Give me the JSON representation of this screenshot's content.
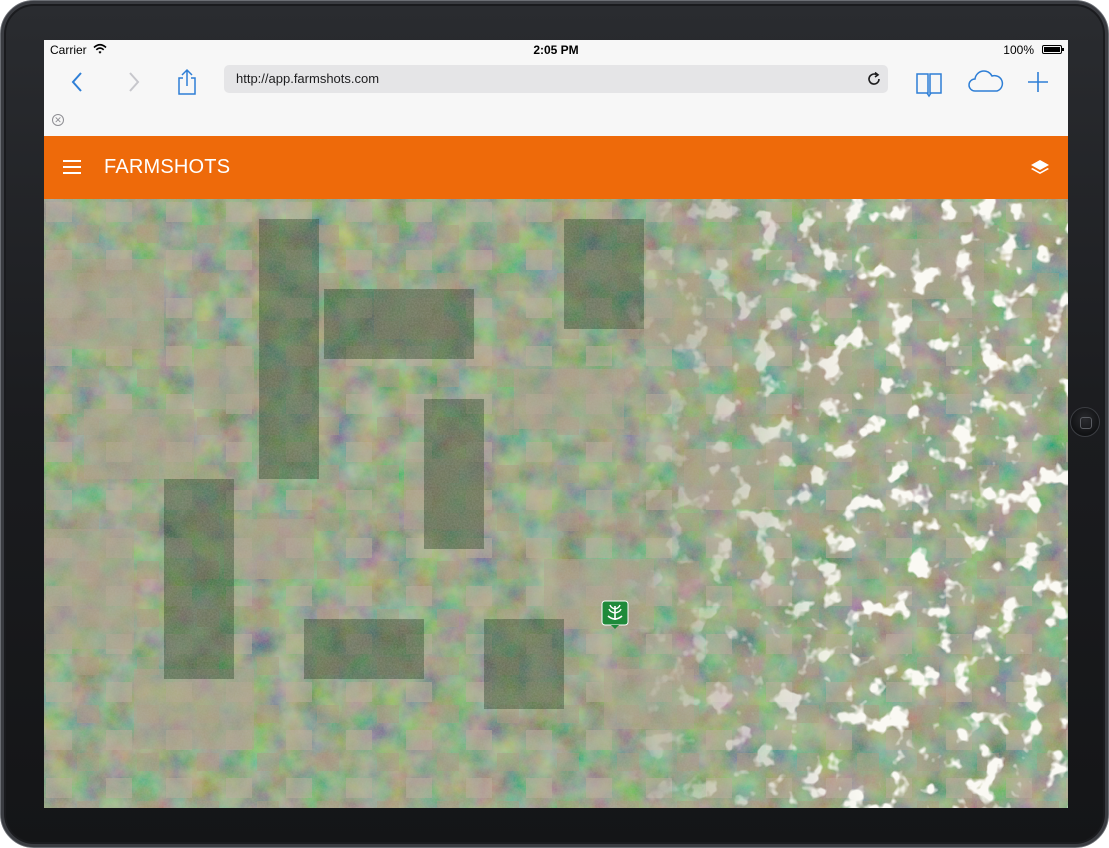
{
  "status_bar": {
    "carrier": "Carrier",
    "time": "2:05 PM",
    "battery": "100%"
  },
  "browser": {
    "url": "http://app.farmshots.com",
    "accent_color": "#2f7fd6"
  },
  "app": {
    "title": "FARMSHOTS",
    "header_color": "#ee6a0a",
    "marker_color": "#1f8a3a"
  },
  "icons": {
    "back": "chevron-left-icon",
    "forward": "chevron-right-icon",
    "share": "share-icon",
    "reload": "reload-icon",
    "bookmarks": "book-icon",
    "cloud": "cloud-icon",
    "new_tab": "plus-icon",
    "tab_close": "close-icon",
    "menu": "hamburger-icon",
    "layers": "layers-icon",
    "marker": "farm-marker-icon"
  }
}
